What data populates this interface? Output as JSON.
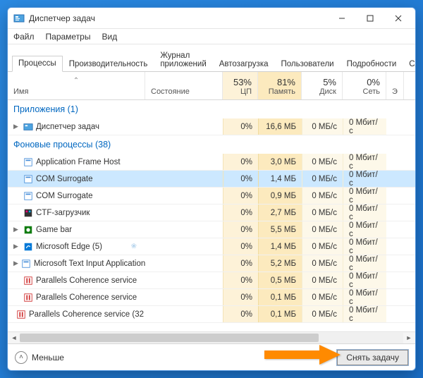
{
  "window": {
    "title": "Диспетчер задач"
  },
  "menu": {
    "file": "Файл",
    "options": "Параметры",
    "view": "Вид"
  },
  "tabs": {
    "processes": "Процессы",
    "performance": "Производительность",
    "app_history": "Журнал приложений",
    "startup": "Автозагрузка",
    "users": "Пользователи",
    "details": "Подробности",
    "services": "Службы"
  },
  "columns": {
    "name": "Имя",
    "status": "Состояние",
    "cpu_pct": "53%",
    "cpu_lbl": "ЦП",
    "mem_pct": "81%",
    "mem_lbl": "Память",
    "disk_pct": "5%",
    "disk_lbl": "Диск",
    "net_pct": "0%",
    "net_lbl": "Сеть",
    "extra": "Э"
  },
  "groups": {
    "apps": "Приложения (1)",
    "background": "Фоновые процессы (38)"
  },
  "rows": [
    {
      "name": "Диспетчер задач",
      "cpu": "0%",
      "mem": "16,6 МБ",
      "disk": "0 МБ/с",
      "net": "0 Мбит/с",
      "icon": "task-manager",
      "expandable": true
    },
    {
      "name": "Application Frame Host",
      "cpu": "0%",
      "mem": "3,0 МБ",
      "disk": "0 МБ/с",
      "net": "0 Мбит/с",
      "icon": "generic"
    },
    {
      "name": "COM Surrogate",
      "cpu": "0%",
      "mem": "1,4 МБ",
      "disk": "0 МБ/с",
      "net": "0 Мбит/с",
      "icon": "generic",
      "selected": true
    },
    {
      "name": "COM Surrogate",
      "cpu": "0%",
      "mem": "0,9 МБ",
      "disk": "0 МБ/с",
      "net": "0 Мбит/с",
      "icon": "generic"
    },
    {
      "name": "CTF-загрузчик",
      "cpu": "0%",
      "mem": "2,7 МБ",
      "disk": "0 МБ/с",
      "net": "0 Мбит/с",
      "icon": "ctf"
    },
    {
      "name": "Game bar",
      "cpu": "0%",
      "mem": "5,5 МБ",
      "disk": "0 МБ/с",
      "net": "0 Мбит/с",
      "icon": "gamebar",
      "expandable": true
    },
    {
      "name": "Microsoft Edge (5)",
      "cpu": "0%",
      "mem": "1,4 МБ",
      "disk": "0 МБ/с",
      "net": "0 Мбит/с",
      "icon": "edge",
      "expandable": true,
      "leaf": true
    },
    {
      "name": "Microsoft Text Input Application",
      "cpu": "0%",
      "mem": "5,2 МБ",
      "disk": "0 МБ/с",
      "net": "0 Мбит/с",
      "icon": "generic",
      "expandable": true
    },
    {
      "name": "Parallels Coherence service",
      "cpu": "0%",
      "mem": "0,5 МБ",
      "disk": "0 МБ/с",
      "net": "0 Мбит/с",
      "icon": "parallels"
    },
    {
      "name": "Parallels Coherence service",
      "cpu": "0%",
      "mem": "0,1 МБ",
      "disk": "0 МБ/с",
      "net": "0 Мбит/с",
      "icon": "parallels"
    },
    {
      "name": "Parallels Coherence service (32 …",
      "cpu": "0%",
      "mem": "0,1 МБ",
      "disk": "0 МБ/с",
      "net": "0 Мбит/с",
      "icon": "parallels"
    }
  ],
  "footer": {
    "fewer": "Меньше",
    "end_task": "Снять задачу"
  }
}
